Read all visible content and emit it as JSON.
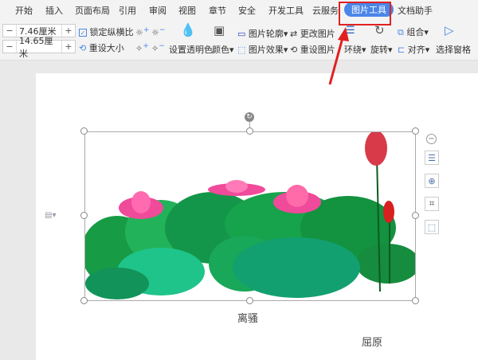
{
  "menu": {
    "tabs": [
      "开始",
      "插入",
      "页面布局",
      "引用",
      "审阅",
      "视图",
      "章节",
      "安全",
      "开发工具",
      "云服务",
      "图片工具",
      "文档助手"
    ],
    "active": "图片工具"
  },
  "toolbar": {
    "height_value": "7.46厘米",
    "width_value": "14.65厘米",
    "minus": "−",
    "plus": "+",
    "lock_ratio": "锁定纵横比",
    "reset_size": "重设大小",
    "set_transparent": "设置透明色",
    "color": "颜色",
    "outline": "图片轮廓",
    "effects": "图片效果",
    "change_picture": "更改图片",
    "reset_picture": "重设图片",
    "wrap": "环绕",
    "rotate": "旋转",
    "group": "组合",
    "align": "对齐",
    "selection_pane": "选择窗格"
  },
  "document": {
    "caption": "离骚",
    "author": "屈原"
  },
  "colors": {
    "accent": "#4a86e8",
    "highlight": "#e02020"
  }
}
